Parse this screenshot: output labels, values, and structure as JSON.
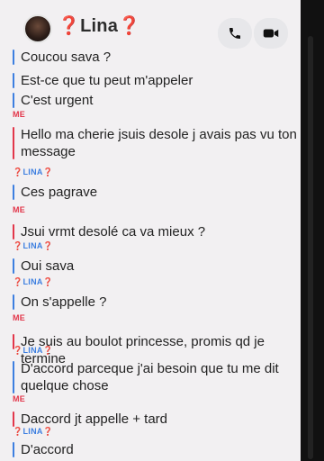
{
  "header": {
    "title": "❓Lina❓",
    "call_icon": "phone-icon",
    "video_icon": "video-camera-icon",
    "next_icon": "chevron-right-icon"
  },
  "colors": {
    "me": "#e2374b",
    "lina": "#3d7fe0",
    "background": "#f2f0f2"
  },
  "messages": [
    {
      "sender": "",
      "who": "lina",
      "text": "Coucou sava ?"
    },
    {
      "sender": "",
      "who": "lina",
      "text": "Est-ce que tu peut m'appeler"
    },
    {
      "sender": "",
      "who": "lina",
      "text": "C'est urgent"
    },
    {
      "sender": "ME",
      "who": "me",
      "text": "Hello ma cherie jsuis desole j avais pas vu ton\nmessage"
    },
    {
      "sender": "❓LINA❓",
      "who": "lina",
      "text": "Ces pagrave"
    },
    {
      "sender": "ME",
      "who": "me",
      "text": "Jsui vrmt desolé ca va mieux ?"
    },
    {
      "sender": "❓LINA❓",
      "who": "lina",
      "text": "Oui sava"
    },
    {
      "sender": "❓LINA❓",
      "who": "lina",
      "text": "On s'appelle ?"
    },
    {
      "sender": "ME",
      "who": "me",
      "text": "Je suis au boulot princesse, promis qd je termine"
    },
    {
      "sender": "❓LINA❓",
      "who": "lina",
      "text": "D'accord parceque j'ai besoin que tu me dit\nquelque chose"
    },
    {
      "sender": "ME",
      "who": "me",
      "text": "Daccord jt appelle + tard"
    },
    {
      "sender": "❓LINA❓",
      "who": "lina",
      "text": "D'accord"
    }
  ]
}
